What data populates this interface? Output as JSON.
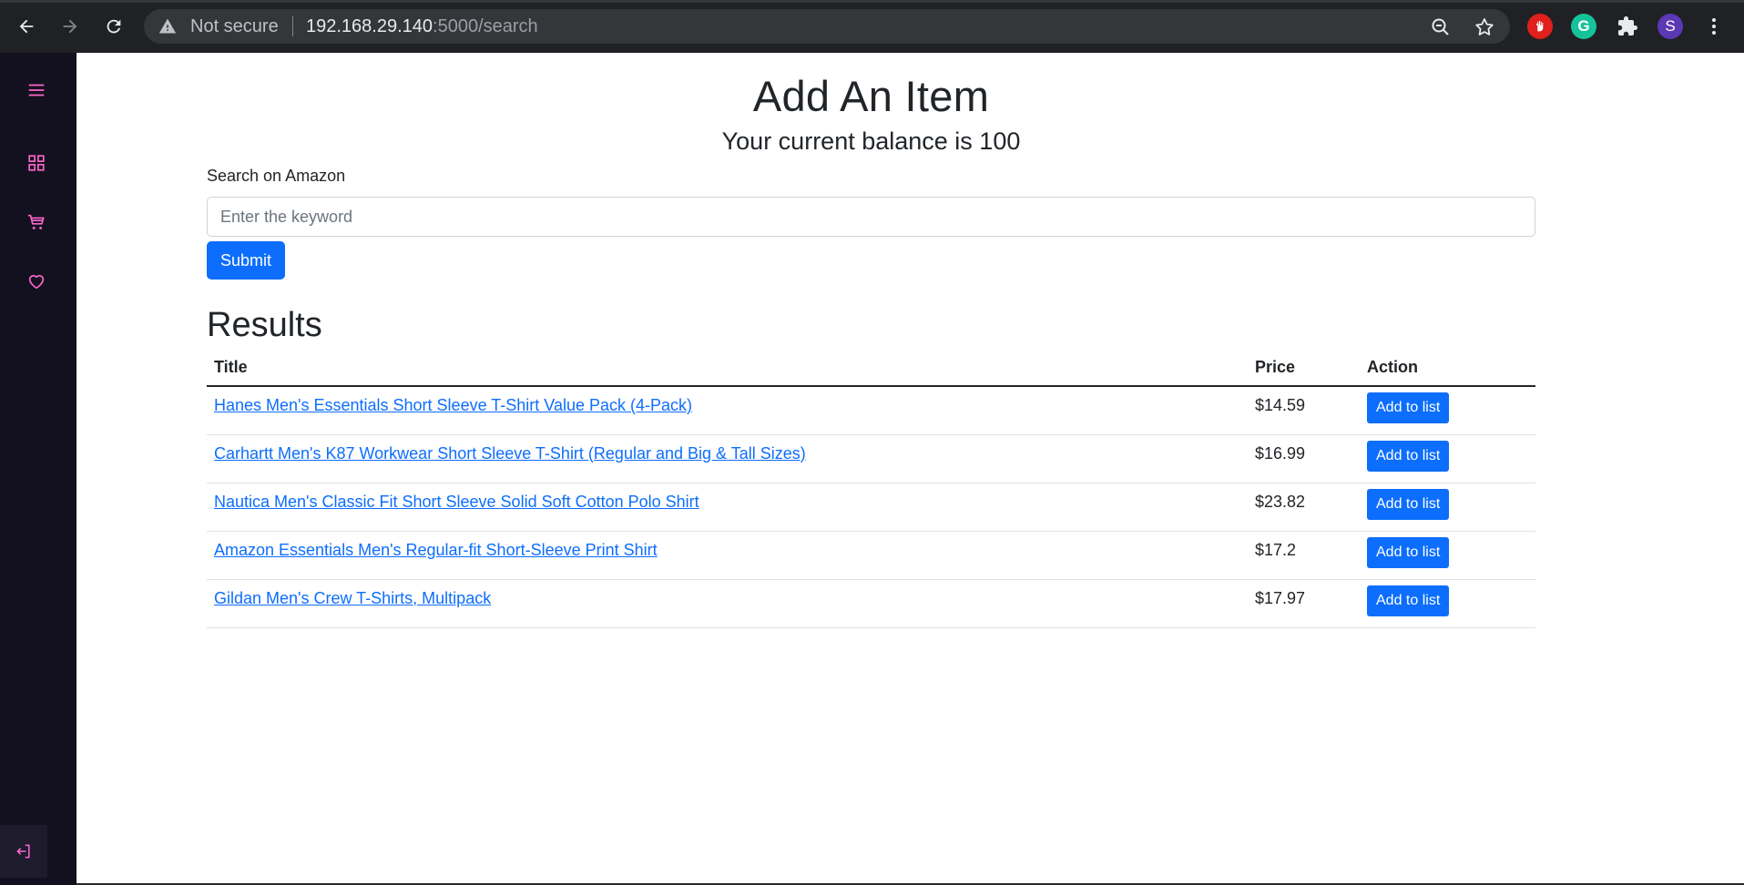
{
  "browser": {
    "security_label": "Not secure",
    "url_host": "192.168.29.140",
    "url_path": ":5000/search",
    "profile_initial": "S",
    "extension_g_label": "G"
  },
  "sidebar": {
    "items": [
      {
        "name": "menu",
        "icon": "hamburger-menu-icon"
      },
      {
        "name": "dashboard",
        "icon": "grid-icon"
      },
      {
        "name": "cart",
        "icon": "cart-icon"
      },
      {
        "name": "wishlist",
        "icon": "heart-icon"
      }
    ],
    "logout_icon": "logout-icon",
    "accent_color": "#ff66cc"
  },
  "page": {
    "title": "Add An Item",
    "balance_prefix": "Your current balance is ",
    "balance_value": "100",
    "search_label": "Search on Amazon",
    "search_placeholder": "Enter the keyword",
    "search_value": "",
    "submit_label": "Submit",
    "results_title": "Results"
  },
  "table": {
    "headers": {
      "title": "Title",
      "price": "Price",
      "action": "Action"
    },
    "rows": [
      {
        "title": "Hanes Men's Essentials Short Sleeve T-Shirt Value Pack (4-Pack)",
        "price": "$14.59",
        "action": "Add to list"
      },
      {
        "title": "Carhartt Men's K87 Workwear Short Sleeve T-Shirt (Regular and Big & Tall Sizes)",
        "price": "$16.99",
        "action": "Add to list"
      },
      {
        "title": "Nautica Men's Classic Fit Short Sleeve Solid Soft Cotton Polo Shirt",
        "price": "$23.82",
        "action": "Add to list"
      },
      {
        "title": "Amazon Essentials Men's Regular-fit Short-Sleeve Print Shirt",
        "price": "$17.2",
        "action": "Add to list"
      },
      {
        "title": "Gildan Men's Crew T-Shirts, Multipack",
        "price": "$17.97",
        "action": "Add to list"
      }
    ]
  },
  "colors": {
    "primary": "#0d6efd",
    "sidebar_bg": "#13111f",
    "chrome_bg": "#202124"
  }
}
